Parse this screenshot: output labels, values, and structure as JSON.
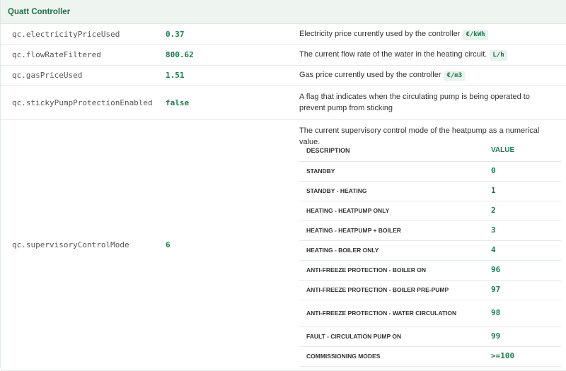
{
  "section": {
    "title": "Quatt Controller"
  },
  "rows": [
    {
      "name": "qc.electricityPriceUsed",
      "value": "0.37",
      "description": "Electricity price currently used by the controller",
      "unit": "€/kWh"
    },
    {
      "name": "qc.flowRateFiltered",
      "value": "800.62",
      "description": "The current flow rate of the water in the heating circuit.",
      "unit": "L/h"
    },
    {
      "name": "qc.gasPriceUsed",
      "value": "1.51",
      "description": "Gas price currently used by the controller",
      "unit": "€/m3"
    },
    {
      "name": "qc.stickyPumpProtectionEnabled",
      "value": "false",
      "description": "A flag that indicates when the circulating pump is being operated to prevent pump from sticking"
    }
  ],
  "supervisory": {
    "name": "qc.supervisoryControlMode",
    "value": "6",
    "description": "The current supervisory control mode of the heatpump as a numerical value.",
    "table": {
      "header_description": "DESCRIPTION",
      "header_value": "VALUE",
      "rows": [
        {
          "description": "STANDBY",
          "value": "0"
        },
        {
          "description": "STANDBY - HEATING",
          "value": "1"
        },
        {
          "description": "HEATING - HEATPUMP ONLY",
          "value": "2"
        },
        {
          "description": "HEATING - HEATPUMP + BOILER",
          "value": "3"
        },
        {
          "description": "HEATING - BOILER ONLY",
          "value": "4"
        },
        {
          "description": "ANTI-FREEZE PROTECTION - BOILER ON",
          "value": "96"
        },
        {
          "description": "ANTI-FREEZE PROTECTION - BOILER PRE-PUMP",
          "value": "97"
        },
        {
          "description": "ANTI-FREEZE PROTECTION - WATER CIRCULATION",
          "value": "98"
        },
        {
          "description": "FAULT - CIRCULATION PUMP ON",
          "value": "99"
        },
        {
          "description": "COMMISSIONING MODES",
          "value": ">=100"
        }
      ]
    }
  }
}
